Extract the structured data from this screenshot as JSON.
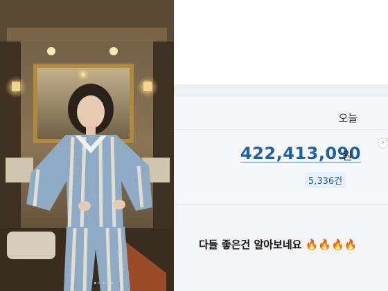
{
  "stats": {
    "period_label": "오늘",
    "amount": "422,413,090",
    "currency": "원",
    "count": "5,336건"
  },
  "caption": {
    "text": "다들 좋은건 알아보네요",
    "emoji": "🔥🔥🔥🔥"
  },
  "colors": {
    "amount_blue": "#1f5fa7",
    "pajama_blue": "#8eaac4",
    "pajama_stripe": "#e9e3d4"
  },
  "icons": {
    "next": "chevron-right-icon"
  }
}
